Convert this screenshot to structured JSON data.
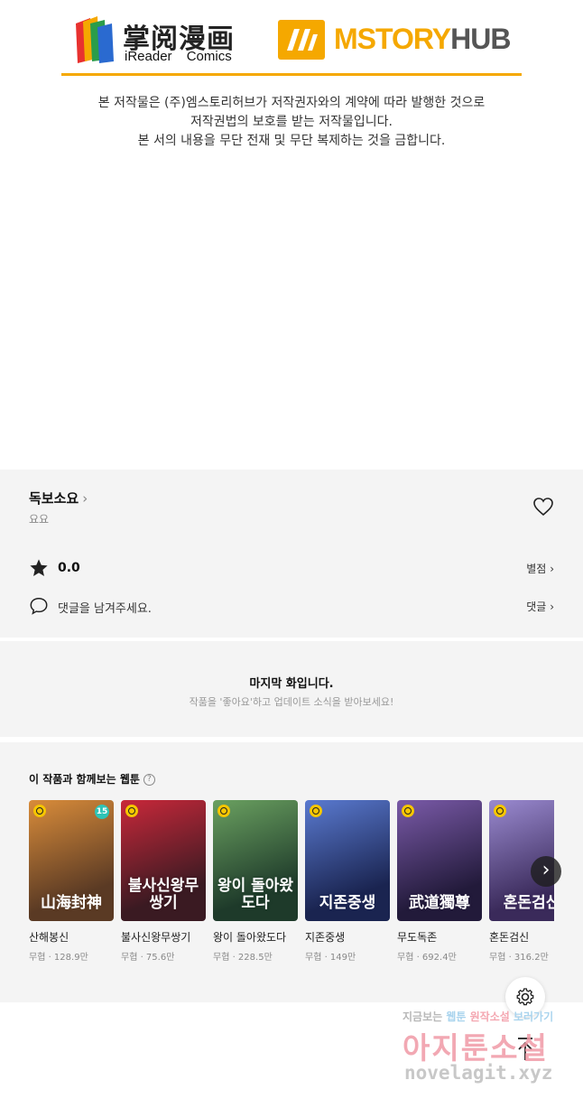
{
  "banner": {
    "ireader_cn": "掌阅漫画",
    "ireader_en": "iReader Comics",
    "mstory_main": "MSTORY",
    "mstory_hub": "HUB",
    "notice_lines": [
      "본 저작물은 (주)엠스토리허브가 저작권자와의 계약에 따라 발행한 것으로",
      "저작권법의 보호를 받는 저작물입니다.",
      "본 서의 내용을 무단 전재 및 무단 복제하는 것을 금합니다."
    ],
    "colors": {
      "accent": "#f5a800"
    }
  },
  "work": {
    "title": "독보소요",
    "author": "요요",
    "rating": "0.0",
    "rate_link": "별점",
    "comment_prompt": "댓글을 남겨주세요.",
    "comment_link": "댓글"
  },
  "last_episode": {
    "title": "마지막 화입니다.",
    "subtitle": "작품을 '좋아요'하고 업데이트 소식을 받아보세요!"
  },
  "recommend": {
    "heading": "이 작품과 함께보는 웹툰",
    "items": [
      {
        "name": "산해봉신",
        "meta": "무협 · 128.9만",
        "cover_text": "山海封神",
        "age_badge": "15",
        "colors": [
          "#5a3a24",
          "#d98c3a"
        ]
      },
      {
        "name": "불사신왕무쌍기",
        "meta": "무협 · 75.6만",
        "cover_text": "불사신왕무쌍기",
        "age_badge": "",
        "colors": [
          "#3a1a22",
          "#c8283a"
        ]
      },
      {
        "name": "왕이 돌아왔도다",
        "meta": "무협 · 228.5만",
        "cover_text": "왕이 돌아왔도다",
        "age_badge": "",
        "colors": [
          "#1e3a2a",
          "#6aa060"
        ]
      },
      {
        "name": "지존중생",
        "meta": "무협 · 149만",
        "cover_text": "지존중생",
        "age_badge": "",
        "colors": [
          "#1a2450",
          "#5a7ad0"
        ]
      },
      {
        "name": "무도독존",
        "meta": "무협 · 692.4만",
        "cover_text": "武道獨尊",
        "age_badge": "",
        "colors": [
          "#221a3a",
          "#7a5aa8"
        ]
      },
      {
        "name": "혼돈검신",
        "meta": "무협 · 316.2만",
        "cover_text": "혼돈검신",
        "age_badge": "",
        "colors": [
          "#3a2a5a",
          "#9a8ad0"
        ]
      }
    ]
  },
  "watermark": {
    "line1_a": "지금보는 ",
    "line1_b": "웹툰 ",
    "line1_c": "원작소설 ",
    "line1_d": "보러가기",
    "line2": "아지툰소설",
    "line3": "novelagit.xyz"
  }
}
